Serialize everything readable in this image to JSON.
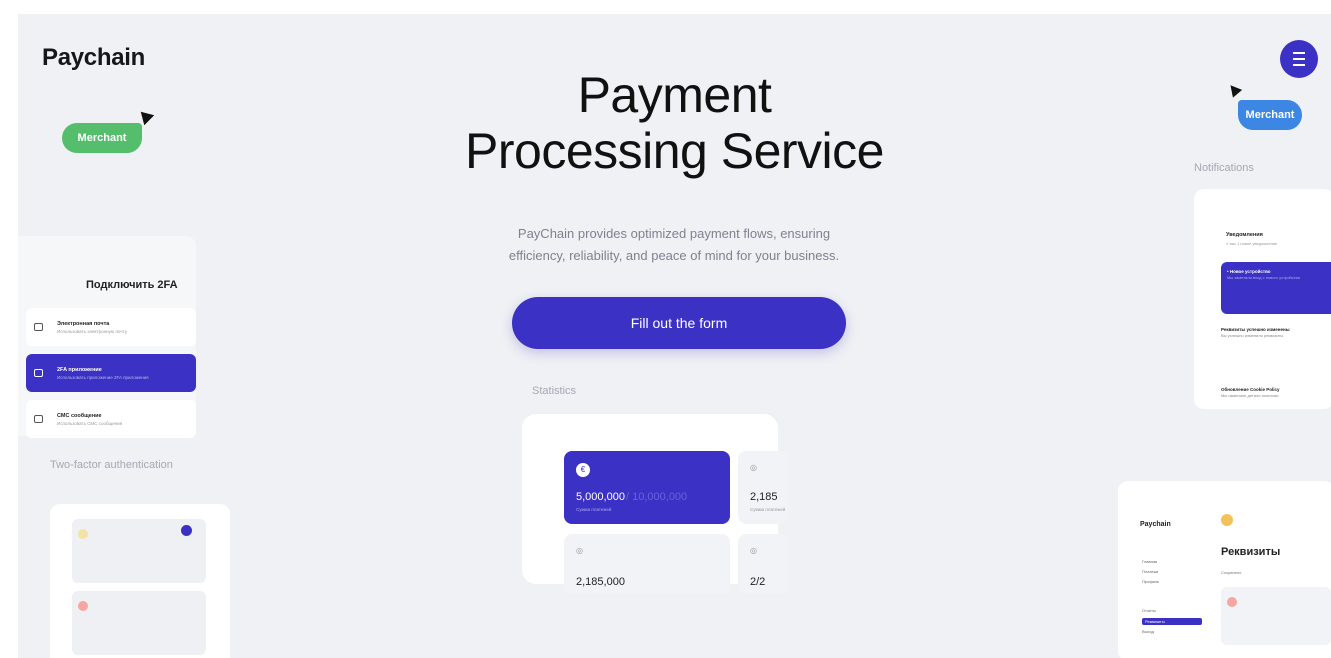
{
  "brand": {
    "logo": "Paychain"
  },
  "labels": {
    "merchant_left": "Merchant",
    "merchant_right": "Merchant"
  },
  "hero": {
    "title_line1": "Payment",
    "title_line2": "Processing Service",
    "subtitle_line1": "PayChain provides optimized payment flows, ensuring",
    "subtitle_line2": "efficiency, reliability, and peace of mind for your business.",
    "cta_label": "Fill out the form"
  },
  "captions": {
    "statistics": "Statistics",
    "two_factor": "Two-factor authentication",
    "notifications": "Notifications"
  },
  "twofa": {
    "title": "Подключить 2FA",
    "items": [
      {
        "title": "Электронная почта",
        "subtitle": "Использовать электронную почту",
        "active": false
      },
      {
        "title": "2FA приложение",
        "subtitle": "Использовать приложение 2FA приложения",
        "active": true
      },
      {
        "title": "СМС сообщение",
        "subtitle": "Использовать СМС сообщения",
        "active": false
      }
    ]
  },
  "stats": {
    "main_value": "5,000,000",
    "main_secondary": "/ 10,000,000",
    "main_label": "Сумма платежей",
    "tile2_value": "2,185",
    "tile2_label": "Сумма платежей",
    "tile3_value": "2,185,000",
    "tile4_value": "2/2"
  },
  "notifications": {
    "title": "Уведомления",
    "subtitle": "У вас 1 новое уведомление",
    "items": [
      {
        "title": "• Новое устройство",
        "subtitle": "Мы заметили вход с нового устройства",
        "active": true
      },
      {
        "title": "Реквизиты успешно изменены",
        "subtitle": "Вы успешно изменили реквизиты",
        "active": false
      },
      {
        "title": "Обновление Cookie Policy",
        "subtitle": "Мы изменили детали политики",
        "active": false
      }
    ]
  },
  "requisites": {
    "logo": "Paychain",
    "title": "Реквизиты",
    "subtitle": "Сохранено",
    "nav": [
      "Главная",
      "Платежи",
      "Профиль",
      "Отчеты",
      "Реквизиты",
      "Выход"
    ],
    "active_nav": "Реквизиты"
  },
  "colors": {
    "primary": "#3b32c5",
    "green": "#54be6d",
    "blue": "#3c86e4",
    "background": "#f0f1f4"
  }
}
